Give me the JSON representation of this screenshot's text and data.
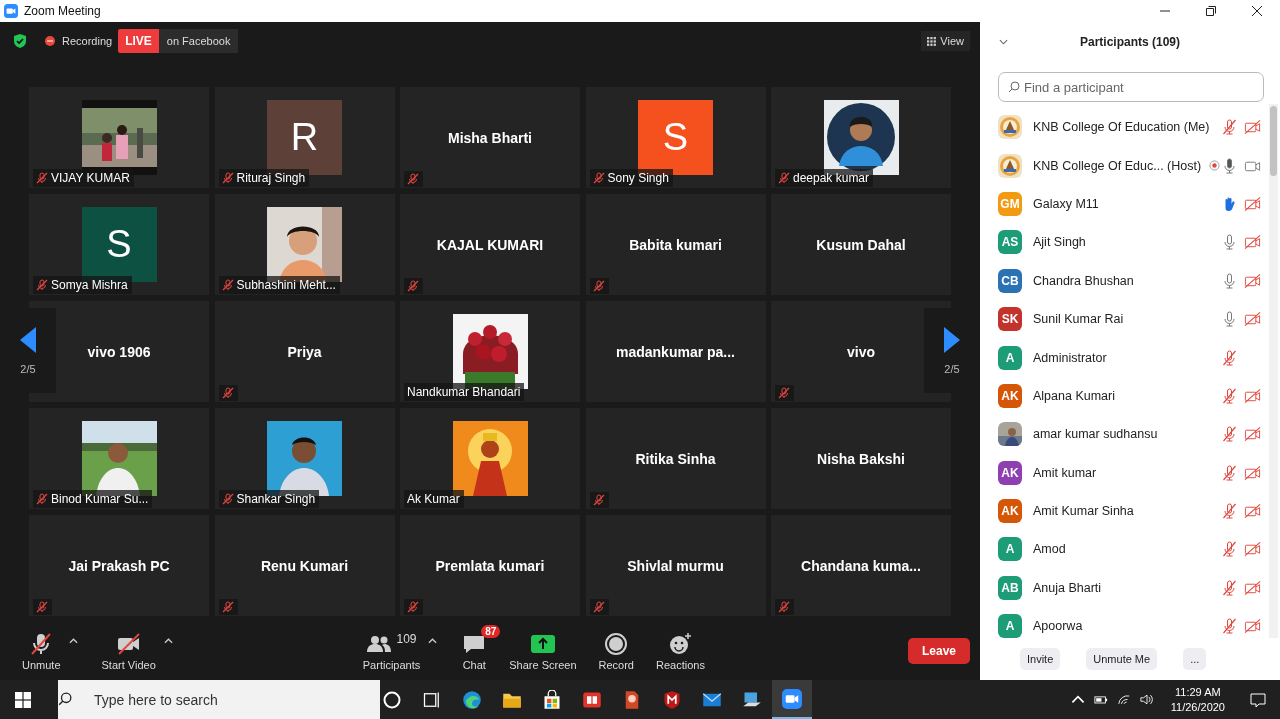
{
  "window": {
    "title": "Zoom Meeting"
  },
  "top_bar": {
    "recording": "Recording",
    "live": "LIVE",
    "live_target": "on Facebook",
    "view": "View"
  },
  "grid": {
    "page_left": "2/5",
    "page_right": "2/5",
    "tiles": [
      {
        "name": "VIJAY KUMAR",
        "kind": "picture",
        "muted": true
      },
      {
        "name": "Rituraj Singh",
        "kind": "letter",
        "letter": "R",
        "color": "#5d4037",
        "muted": true
      },
      {
        "name": "Misha Bharti",
        "kind": "text",
        "muted": true
      },
      {
        "name": "Sony Singh",
        "kind": "letter",
        "letter": "S",
        "color": "#f4511e",
        "muted": true
      },
      {
        "name": "deepak kumar",
        "kind": "picture",
        "muted": true
      },
      {
        "name": "Somya Mishra",
        "kind": "letter",
        "letter": "S",
        "color": "#0d5143",
        "muted": true
      },
      {
        "name": "Subhashini Meht...",
        "kind": "picture",
        "muted": true
      },
      {
        "name": "KAJAL KUMARI",
        "kind": "text",
        "muted": true
      },
      {
        "name": "Babita kumari",
        "kind": "text",
        "muted": true
      },
      {
        "name": "Kusum Dahal",
        "kind": "text",
        "muted": false
      },
      {
        "name": "vivo 1906",
        "kind": "text",
        "muted": false
      },
      {
        "name": "Priya",
        "kind": "text",
        "muted": true
      },
      {
        "name": "Nandkumar Bhandari",
        "kind": "picture",
        "muted": false
      },
      {
        "name": "madankumar  pa...",
        "kind": "text",
        "muted": false
      },
      {
        "name": "vivo",
        "kind": "text",
        "muted": true
      },
      {
        "name": "Binod Kumar Su...",
        "kind": "picture",
        "muted": true
      },
      {
        "name": "Shankar Singh",
        "kind": "picture",
        "muted": true
      },
      {
        "name": "Ak Kumar",
        "kind": "picture",
        "muted": false
      },
      {
        "name": "Ritika Sinha",
        "kind": "text",
        "muted": true
      },
      {
        "name": "Nisha Bakshi",
        "kind": "text",
        "muted": false
      },
      {
        "name": "Jai Prakash PC",
        "kind": "text",
        "muted": true
      },
      {
        "name": "Renu Kumari",
        "kind": "text",
        "muted": true
      },
      {
        "name": "Premlata kumari",
        "kind": "text",
        "muted": true
      },
      {
        "name": "Shivlal murmu",
        "kind": "text",
        "muted": true
      },
      {
        "name": "Chandana  kuma...",
        "kind": "text",
        "muted": true
      }
    ]
  },
  "toolbar": {
    "items": [
      {
        "kind": "unmute",
        "label": "Unmute"
      },
      {
        "kind": "video",
        "label": "Start Video"
      },
      {
        "kind": "participants",
        "label": "Participants",
        "count": "109"
      },
      {
        "kind": "chat",
        "label": "Chat",
        "badge": "87"
      },
      {
        "kind": "share",
        "label": "Share Screen"
      },
      {
        "kind": "record",
        "label": "Record"
      },
      {
        "kind": "reactions",
        "label": "Reactions"
      }
    ],
    "leave": "Leave"
  },
  "panel": {
    "title": "Participants (109)",
    "search_placeholder": "Find a participant",
    "participants": [
      {
        "name": "KNB College Of Education (Me)",
        "kind": "picture",
        "muted": true,
        "hand_raised": false,
        "camera_on": false,
        "recording": false
      },
      {
        "name": "KNB College Of Educ... (Host)",
        "kind": "picture",
        "muted": false,
        "hand_raised": false,
        "camera_on": true,
        "recording": true
      },
      {
        "name": "Galaxy M11",
        "kind": "initials",
        "initials": "GM",
        "color": "#f29b12",
        "hand_raised": true,
        "camera_on": false,
        "recording": false
      },
      {
        "name": "Ajit Singh",
        "kind": "initials",
        "initials": "AS",
        "color": "#1d9d77",
        "muted": false,
        "hand_raised": false,
        "camera_on": false,
        "recording": false
      },
      {
        "name": "Chandra Bhushan",
        "kind": "initials",
        "initials": "CB",
        "color": "#2b72b5",
        "muted": false,
        "hand_raised": false,
        "camera_on": false,
        "recording": false
      },
      {
        "name": "Sunil Kumar Rai",
        "kind": "initials",
        "initials": "SK",
        "color": "#c2342b",
        "muted": false,
        "hand_raised": false,
        "camera_on": false,
        "recording": false
      },
      {
        "name": "Administrator",
        "kind": "initials",
        "initials": "A",
        "color": "#1d9d77",
        "muted": true,
        "hand_raised": false,
        "recording": false
      },
      {
        "name": "Alpana Kumari",
        "kind": "initials",
        "initials": "AK",
        "color": "#d55606",
        "muted": true,
        "hand_raised": false,
        "camera_on": false,
        "recording": false
      },
      {
        "name": "amar kumar sudhansu",
        "kind": "picture",
        "muted": true,
        "hand_raised": false,
        "camera_on": false,
        "recording": false
      },
      {
        "name": "Amit kumar",
        "kind": "initials",
        "initials": "AK",
        "color": "#8e3fb0",
        "muted": true,
        "hand_raised": false,
        "camera_on": false,
        "recording": false
      },
      {
        "name": "Amit Kumar Sinha",
        "kind": "initials",
        "initials": "AK",
        "color": "#d55606",
        "muted": true,
        "hand_raised": false,
        "camera_on": false,
        "recording": false
      },
      {
        "name": "Amod",
        "kind": "initials",
        "initials": "A",
        "color": "#1d9d77",
        "muted": true,
        "hand_raised": false,
        "camera_on": false,
        "recording": false
      },
      {
        "name": "Anuja Bharti",
        "kind": "initials",
        "initials": "AB",
        "color": "#1d9d77",
        "muted": true,
        "hand_raised": false,
        "camera_on": false,
        "recording": false
      },
      {
        "name": "Apoorwa",
        "kind": "initials",
        "initials": "A",
        "color": "#1d9d77",
        "muted": true,
        "hand_raised": false,
        "camera_on": false,
        "recording": false
      }
    ],
    "buttons": [
      "Invite",
      "Unmute Me",
      "..."
    ]
  },
  "taskbar": {
    "search_placeholder": "Type here to search",
    "time": "11:29 AM",
    "date": "11/26/2020"
  }
}
